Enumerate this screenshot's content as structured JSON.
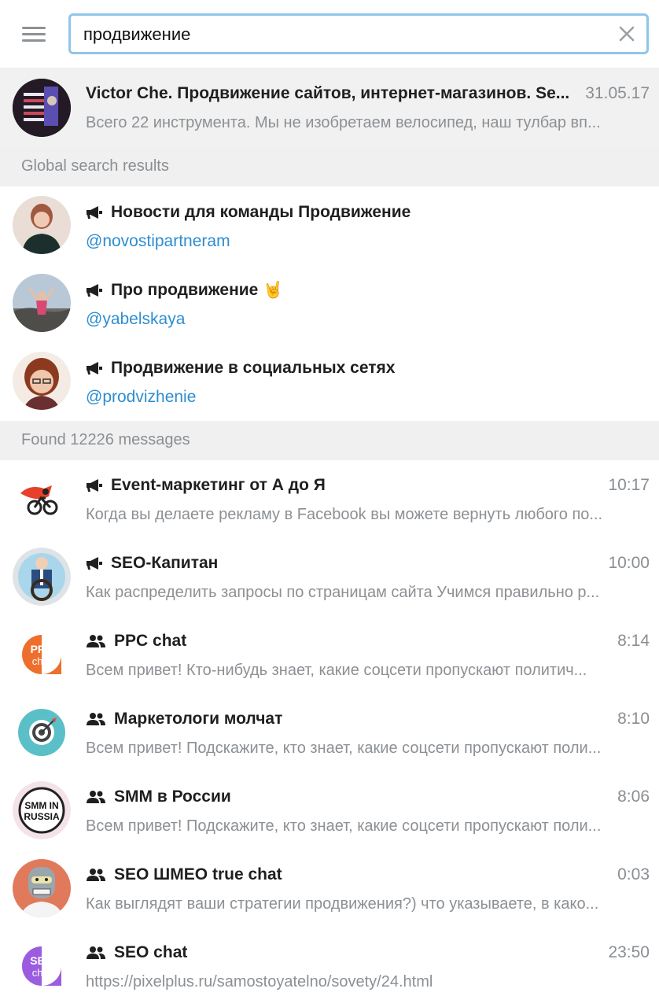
{
  "search": {
    "value": "продвижение",
    "placeholder": ""
  },
  "top_result": {
    "title": "Victor Che. Продвижение сайтов, интернет-магазинов. Se...",
    "date": "31.05.17",
    "preview": "Всего 22 инструмента. Мы не изобретаем велосипед, наш тулбар вп..."
  },
  "global_section": {
    "label": "Global search results"
  },
  "global_results": [
    {
      "title": "Новости для команды Продвижение",
      "username": "@novostipartneram",
      "type_icon": "megaphone-icon"
    },
    {
      "title": "Про продвижение",
      "emoji": "🤘",
      "username": "@yabelskaya",
      "type_icon": "megaphone-icon"
    },
    {
      "title": "Продвижение в социальных сетях",
      "username": "@prodvizhenie",
      "type_icon": "megaphone-icon"
    }
  ],
  "messages_section": {
    "label": "Found 12226 messages"
  },
  "messages": [
    {
      "title": "Event-маркетинг от А до Я",
      "time": "10:17",
      "preview": "Когда вы делаете рекламу в Facebook вы можете вернуть любого по...",
      "type_icon": "megaphone-icon"
    },
    {
      "title": "SEO-Капитан",
      "time": "10:00",
      "preview": "Как распределить запросы по страницам сайта Учимся правильно р...",
      "type_icon": "megaphone-icon"
    },
    {
      "title": "PPC chat",
      "time": "8:14",
      "preview": "Всем привет!  Кто-нибудь знает, какие соцсети пропускают политич...",
      "type_icon": "group-icon",
      "avatar_text": [
        "PPC",
        "chat"
      ]
    },
    {
      "title": "Маркетологи молчат",
      "time": "8:10",
      "preview": "Всем привет! Подскажите, кто знает, какие соцсети пропускают поли...",
      "type_icon": "group-icon"
    },
    {
      "title": "SMM в России",
      "time": "8:06",
      "preview": "Всем привет! Подскажите, кто знает, какие соцсети пропускают поли...",
      "type_icon": "group-icon",
      "avatar_text": [
        "SMM IN",
        "RUSSIA"
      ]
    },
    {
      "title": "SEO ШМЕО true chat",
      "time": "0:03",
      "preview": "Как выглядят ваши стратегии продвижения?) что указываете, в како...",
      "type_icon": "group-icon"
    },
    {
      "title": "SEO chat",
      "time": "23:50",
      "preview": "https://pixelplus.ru/samostoyatelno/sovety/24.html",
      "type_icon": "group-icon",
      "avatar_text": [
        "SEO",
        "chat"
      ]
    }
  ],
  "colors": {
    "link": "#2d8dd0",
    "search_border": "#8fc6ea",
    "section_bg": "#f0f0f0",
    "selected_bg": "#f1f1f1",
    "ppc_orange": "#ee6f2d",
    "seo_purple": "#9b5ce0",
    "target_teal": "#5bbfc8"
  }
}
